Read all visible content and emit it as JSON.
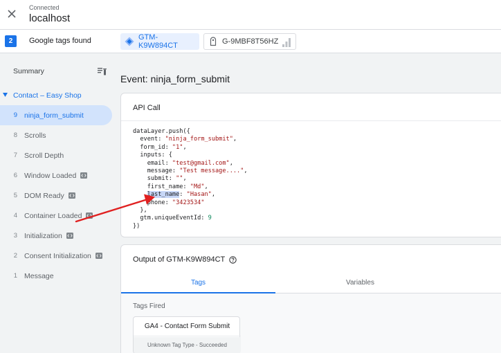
{
  "header": {
    "status": "Connected",
    "host": "localhost"
  },
  "tags_bar": {
    "count": "2",
    "label": "Google tags found",
    "containers": [
      {
        "id": "GTM-K9W894CT",
        "selected": true
      },
      {
        "id": "G-9MBF8T56HZ",
        "selected": false
      }
    ]
  },
  "sidebar": {
    "summary": "Summary",
    "page": "Contact – Easy Shop",
    "events": [
      {
        "num": "9",
        "label": "ninja_form_submit",
        "selected": true,
        "icon": ""
      },
      {
        "num": "8",
        "label": "Scrolls",
        "selected": false,
        "icon": ""
      },
      {
        "num": "7",
        "label": "Scroll Depth",
        "selected": false,
        "icon": ""
      },
      {
        "num": "6",
        "label": "Window Loaded",
        "selected": false,
        "icon": "code-icon"
      },
      {
        "num": "5",
        "label": "DOM Ready",
        "selected": false,
        "icon": "code-icon"
      },
      {
        "num": "4",
        "label": "Container Loaded",
        "selected": false,
        "icon": "code-icon"
      },
      {
        "num": "3",
        "label": "Initialization",
        "selected": false,
        "icon": "code-icon"
      },
      {
        "num": "2",
        "label": "Consent Initialization",
        "selected": false,
        "icon": "code-icon"
      },
      {
        "num": "1",
        "label": "Message",
        "selected": false,
        "icon": ""
      }
    ]
  },
  "main": {
    "event_title": "Event: ninja_form_submit",
    "api_call": {
      "title": "API Call",
      "code": {
        "line1": "dataLayer.push({",
        "event_key": "  event: ",
        "event_val": "\"ninja_form_submit\"",
        "form_id_key": "  form_id: ",
        "form_id_val": "\"1\"",
        "inputs_key": "  inputs: {",
        "email_key": "    email: ",
        "email_val": "\"test@gmail.com\"",
        "message_key": "    message: ",
        "message_val": "\"Test message....\"",
        "submit_key": "    submit: ",
        "submit_val": "\"\"",
        "first_name_key": "    first_name: ",
        "first_name_val": "\"Md\"",
        "last_name_key": "last_name",
        "last_name_val": "\"Hasan\"",
        "phone_key": "    phone: ",
        "phone_val": "\"3423534\"",
        "close_inputs": "  },",
        "uid_key": "  gtm.uniqueEventId: ",
        "uid_val": "9",
        "close": "})"
      }
    },
    "output": {
      "title": "Output of GTM-K9W894CT",
      "tabs": [
        "Tags",
        "Variables"
      ],
      "tags_fired_label": "Tags Fired",
      "tag": {
        "name": "GA4 - Contact Form Submit",
        "status": "Unknown Tag Type - Succeeded"
      }
    }
  },
  "colors": {
    "accent": "#1a73e8",
    "selected_bg": "#d2e3fc",
    "annotation_arrow": "#e02020"
  }
}
